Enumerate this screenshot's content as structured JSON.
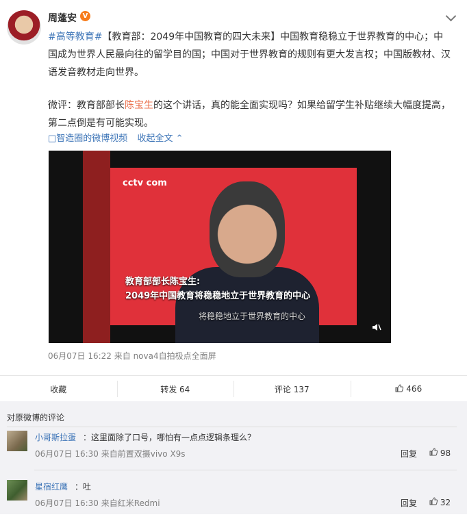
{
  "post": {
    "author": "周蓬安",
    "verified_badge": "V",
    "hashtag": "#高等教育#",
    "text_line1_rest": "【教育部：2049年中国教育的四大未来】中国教育稳稳立于世界教育的中心；中",
    "text_line2": "国成为世界人民最向往的留学目的国；中国对于世界教育的规则有更大发言权；中国版教材、汉",
    "text_line3": "语发音教材走向世界。",
    "comment_prefix": "微评：教育部部长",
    "comment_link": "陈宝生",
    "comment_rest": "的这个讲话，真的能全面实现吗？如果给留学生补贴继续大幅度提高，",
    "comment_line2": "第二点倒是有可能实现。",
    "video_source_link": "□智造圈的微博视频",
    "collapse_link": "收起全文 ⌃",
    "video": {
      "channel_logo": "cctv com",
      "caption_line1": "教育部部长陈宝生:",
      "caption_line2": "2049年中国教育将稳稳地立于世界教育的中心",
      "subtitle": "将稳稳地立于世界教育的中心"
    },
    "meta": "06月07日 16:22  来自 nova4自拍极点全面屏"
  },
  "actions": {
    "favorite": "收藏",
    "repost": "转发 64",
    "comment": "评论 137",
    "like": "466"
  },
  "comments_section": {
    "title": "对原微博的评论",
    "items": [
      {
        "name": "小哥斯拉蛋",
        "text": "：这里面除了口号，哪怕有一点点逻辑条理么？",
        "meta": "06月07日 16:30  来自前置双摄vivo X9s",
        "reply": "回复",
        "likes": "98"
      },
      {
        "name": "星宿红鹰",
        "text": "：吐",
        "meta": "06月07日 16:30  来自红米Redmi",
        "reply": "回复",
        "likes": "32"
      }
    ]
  },
  "icons": {
    "more": "chevron-down-icon",
    "like": "thumb-up-icon",
    "mute": "mute-icon"
  },
  "colors": {
    "link_blue": "#3c74b7",
    "highlight_orange": "#eb7350",
    "badge_orange": "#f77c1c",
    "comment_bg": "#f2f2f5"
  }
}
